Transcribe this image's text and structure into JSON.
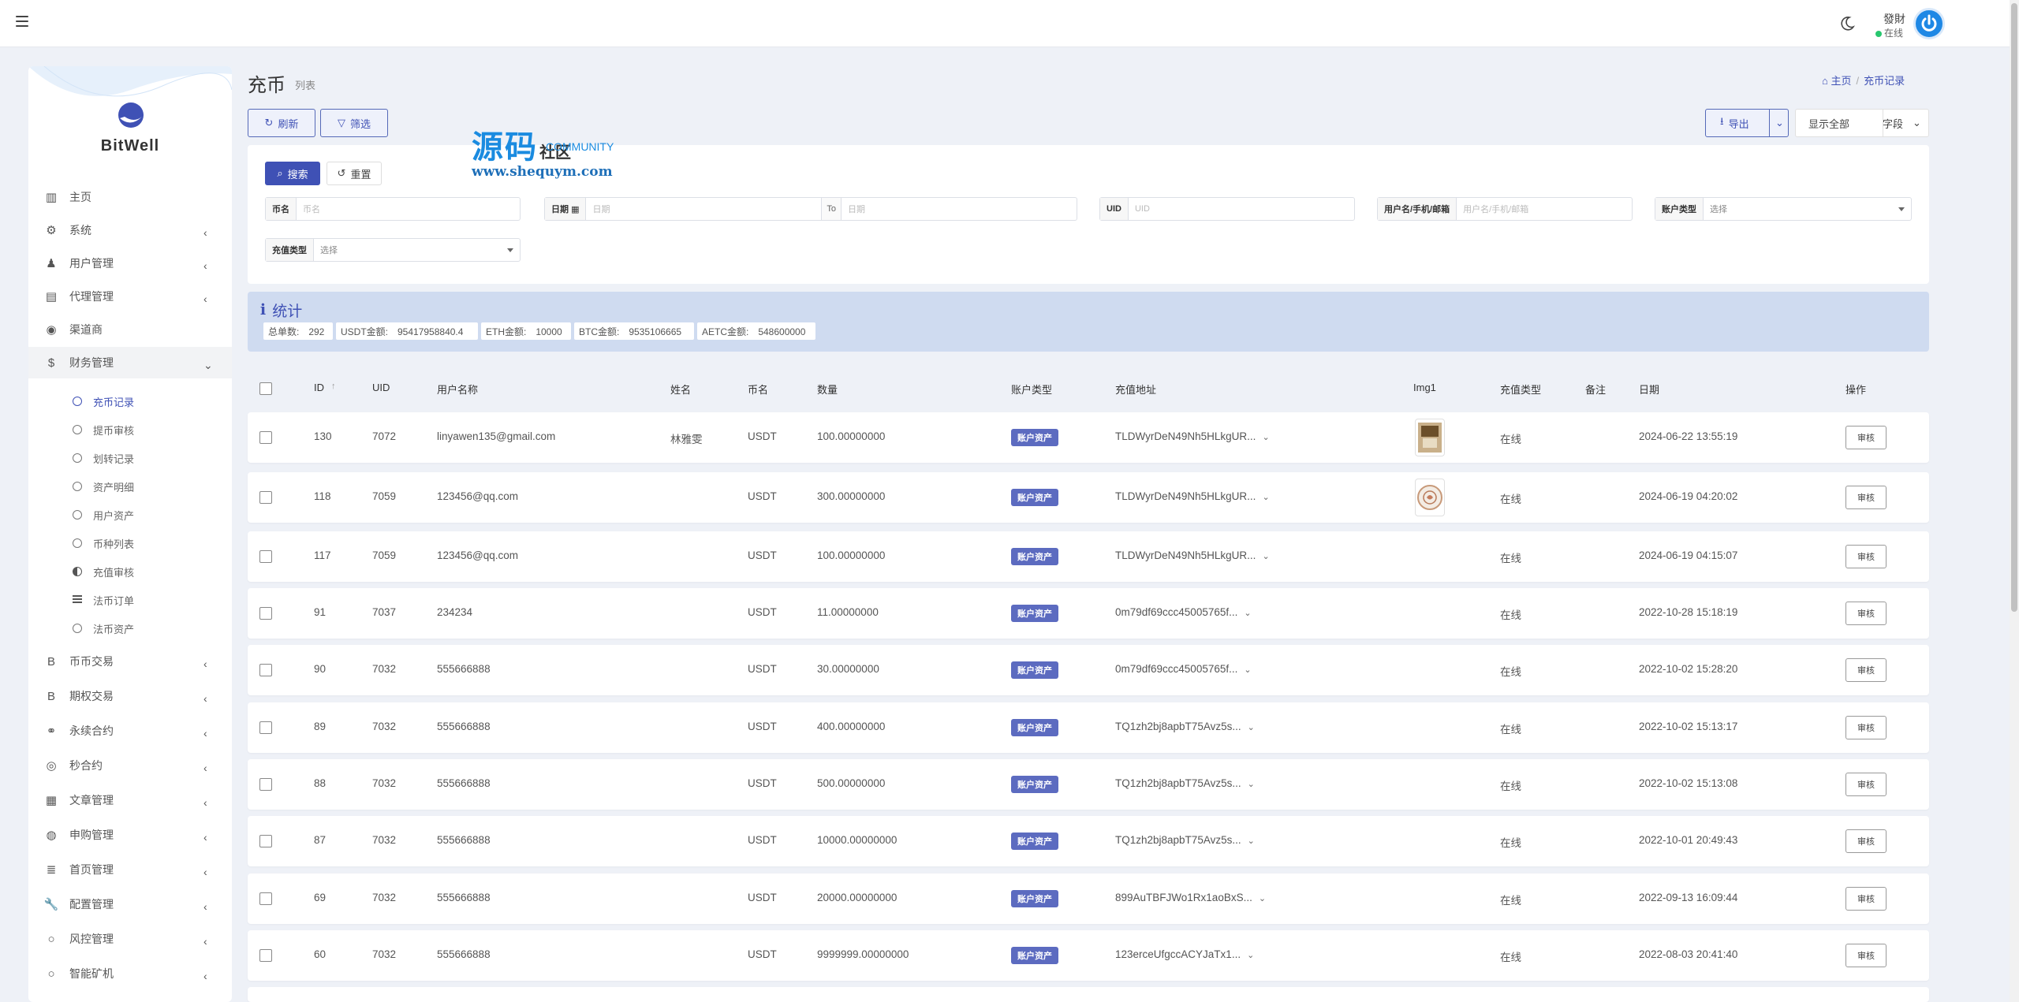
{
  "header": {
    "user_name": "發財",
    "user_status": "在线"
  },
  "sidebar": {
    "brand": "BitWell",
    "items": [
      {
        "label": "主页",
        "icon": "dashboard-icon",
        "chevron": false
      },
      {
        "label": "系统",
        "icon": "gear-icon",
        "chevron": true
      },
      {
        "label": "用户管理",
        "icon": "user-icon",
        "chevron": true
      },
      {
        "label": "代理管理",
        "icon": "id-card-icon",
        "chevron": true
      },
      {
        "label": "渠道商",
        "icon": "user-circle-icon",
        "chevron": false
      },
      {
        "label": "财务管理",
        "icon": "dollar-icon",
        "chevron": true,
        "open": true
      }
    ],
    "sub_items": [
      {
        "label": "充币记录",
        "icon": "circle-icon",
        "active": true
      },
      {
        "label": "提币审核",
        "icon": "circle-icon"
      },
      {
        "label": "划转记录",
        "icon": "circle-icon"
      },
      {
        "label": "资产明细",
        "icon": "circle-icon"
      },
      {
        "label": "用户资产",
        "icon": "circle-icon"
      },
      {
        "label": "币种列表",
        "icon": "circle-icon"
      },
      {
        "label": "充值审核",
        "icon": "half-circle-icon"
      },
      {
        "label": "法币订单",
        "icon": "list-icon"
      },
      {
        "label": "法币资产",
        "icon": "circle-icon"
      }
    ],
    "items2": [
      {
        "label": "币币交易",
        "icon": "bitcoin-icon"
      },
      {
        "label": "期权交易",
        "icon": "bitcoin-icon"
      },
      {
        "label": "永续合约",
        "icon": "link-icon"
      },
      {
        "label": "秒合约",
        "icon": "target-icon"
      },
      {
        "label": "文章管理",
        "icon": "newspaper-icon"
      },
      {
        "label": "申购管理",
        "icon": "globe-icon"
      },
      {
        "label": "首页管理",
        "icon": "list-icon"
      },
      {
        "label": "配置管理",
        "icon": "wrench-icon"
      },
      {
        "label": "风控管理",
        "icon": "circle-icon"
      },
      {
        "label": "智能矿机",
        "icon": "circle-icon"
      }
    ]
  },
  "page": {
    "title": "充币",
    "subtitle": "列表"
  },
  "breadcrumb": {
    "home": "主页",
    "current": "充币记录"
  },
  "toolbar": {
    "refresh": "刷新",
    "filter": "筛选",
    "export": "导出",
    "show_all": "显示全部",
    "fields": "字段"
  },
  "watermark": {
    "cn": "源码",
    "cn2": "社区",
    "en": "COMMUNITY",
    "url": "www.shequym.com"
  },
  "filters": {
    "search_button": "搜索",
    "reset_button": "重置",
    "coin_label": "币名",
    "coin_placeholder": "币名",
    "date_label": "日期",
    "date_placeholder_start": "日期",
    "date_to": "To",
    "date_placeholder_end": "日期",
    "uid_label": "UID",
    "uid_placeholder": "UID",
    "user_label": "用户名/手机/邮箱",
    "user_placeholder": "用户名/手机/邮箱",
    "account_type_label": "账户类型",
    "account_type_value": "选择",
    "recharge_type_label": "充值类型",
    "recharge_type_value": "选择"
  },
  "stats": {
    "title": "统计",
    "pills": [
      "总单数:　292",
      "USDT金额:　95417958840.4",
      "ETH金额:　10000",
      "BTC金额:　9535106665",
      "AETC金额:　548600000"
    ]
  },
  "table": {
    "columns": [
      "ID",
      "UID",
      "用户名称",
      "姓名",
      "币名",
      "数量",
      "账户类型",
      "充值地址",
      "Img1",
      "充值类型",
      "备注",
      "日期",
      "操作"
    ],
    "action_label": "审核",
    "rows": [
      {
        "id": "130",
        "uid": "7072",
        "user": "linyawen135@gmail.com",
        "name": "林雅雯",
        "coin": "USDT",
        "amount": "100.00000000",
        "account": "账户资产",
        "address": "TLDWyrDeN49Nh5HLkgUR...",
        "img": "photo",
        "type": "在线",
        "date": "2024-06-22 13:55:19"
      },
      {
        "id": "118",
        "uid": "7059",
        "user": "123456@qq.com",
        "name": "",
        "coin": "USDT",
        "amount": "300.00000000",
        "account": "账户资产",
        "address": "TLDWyrDeN49Nh5HLkgUR...",
        "img": "badge",
        "type": "在线",
        "date": "2024-06-19 04:20:02"
      },
      {
        "id": "117",
        "uid": "7059",
        "user": "123456@qq.com",
        "name": "",
        "coin": "USDT",
        "amount": "100.00000000",
        "account": "账户资产",
        "address": "TLDWyrDeN49Nh5HLkgUR...",
        "img": "",
        "type": "在线",
        "date": "2024-06-19 04:15:07"
      },
      {
        "id": "91",
        "uid": "7037",
        "user": "234234",
        "name": "",
        "coin": "USDT",
        "amount": "11.00000000",
        "account": "账户资产",
        "address": "0m79df69ccc45005765f...",
        "img": "",
        "type": "在线",
        "date": "2022-10-28 15:18:19"
      },
      {
        "id": "90",
        "uid": "7032",
        "user": "555666888",
        "name": "",
        "coin": "USDT",
        "amount": "30.00000000",
        "account": "账户资产",
        "address": "0m79df69ccc45005765f...",
        "img": "",
        "type": "在线",
        "date": "2022-10-02 15:28:20"
      },
      {
        "id": "89",
        "uid": "7032",
        "user": "555666888",
        "name": "",
        "coin": "USDT",
        "amount": "400.00000000",
        "account": "账户资产",
        "address": "TQ1zh2bj8apbT75Avz5s...",
        "img": "",
        "type": "在线",
        "date": "2022-10-02 15:13:17"
      },
      {
        "id": "88",
        "uid": "7032",
        "user": "555666888",
        "name": "",
        "coin": "USDT",
        "amount": "500.00000000",
        "account": "账户资产",
        "address": "TQ1zh2bj8apbT75Avz5s...",
        "img": "",
        "type": "在线",
        "date": "2022-10-02 15:13:08"
      },
      {
        "id": "87",
        "uid": "7032",
        "user": "555666888",
        "name": "",
        "coin": "USDT",
        "amount": "10000.00000000",
        "account": "账户资产",
        "address": "TQ1zh2bj8apbT75Avz5s...",
        "img": "",
        "type": "在线",
        "date": "2022-10-01 20:49:43"
      },
      {
        "id": "69",
        "uid": "7032",
        "user": "555666888",
        "name": "",
        "coin": "USDT",
        "amount": "20000.00000000",
        "account": "账户资产",
        "address": "899AuTBFJWo1Rx1aoBxS...",
        "img": "",
        "type": "在线",
        "date": "2022-09-13 16:09:44"
      },
      {
        "id": "60",
        "uid": "7032",
        "user": "555666888",
        "name": "",
        "coin": "USDT",
        "amount": "9999999.00000000",
        "account": "账户资产",
        "address": "123erceUfgccACYJaTx1...",
        "img": "",
        "type": "在线",
        "date": "2022-08-03 20:41:40"
      }
    ]
  },
  "colors": {
    "accent": "#3f51b5",
    "badge": "#5c6bc0",
    "online": "#28c76f",
    "stats_bg": "#cfdbf0"
  }
}
